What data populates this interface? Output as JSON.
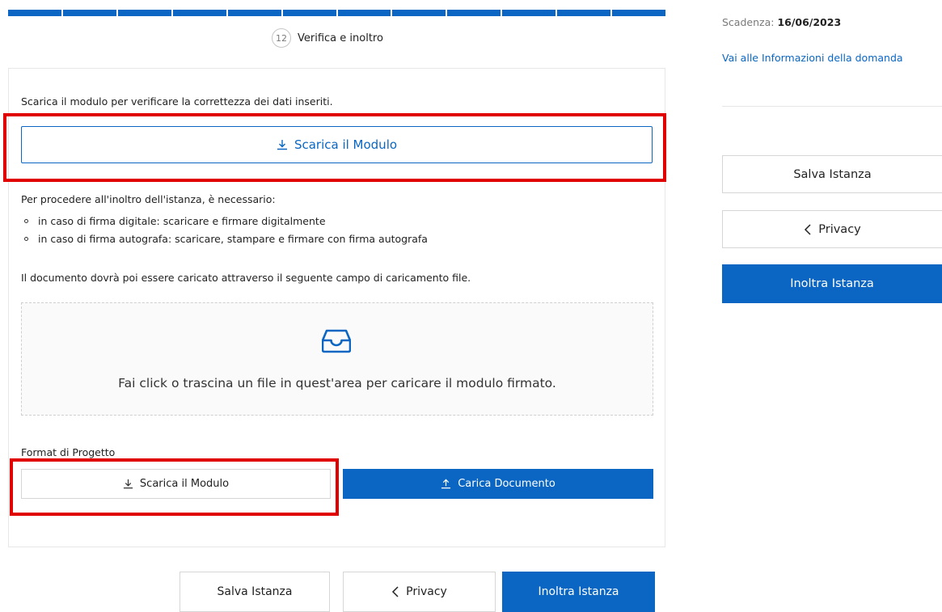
{
  "progress": {
    "total_steps": 12,
    "current_step": 12
  },
  "step": {
    "number": "12",
    "label": "Verifica e inoltro"
  },
  "download_section": {
    "instruction": "Scarica il modulo per verificare la correttezza dei dati inseriti.",
    "download_button": "Scarica il Modulo"
  },
  "requirements": {
    "intro": "Per procedere all'inoltro dell'istanza, è necessario:",
    "items": [
      "in caso di firma digitale: scaricare e firmare digitalmente",
      "in caso di firma autografa: scaricare, stampare e firmare con firma autografa"
    ]
  },
  "upload_note": "Il documento dovrà poi essere caricato attraverso il seguente campo di caricamento file.",
  "dropzone": {
    "message": "Fai click o trascina un file in quest'area per caricare il modulo firmato.",
    "icon": "inbox-icon"
  },
  "format": {
    "label": "Format di Progetto",
    "download_button": "Scarica il Modulo",
    "upload_button": "Carica Documento"
  },
  "footer_actions": {
    "save": "Salva Istanza",
    "privacy": "Privacy",
    "submit": "Inoltra Istanza"
  },
  "sidebar": {
    "deadline_label": "Scadenza:",
    "deadline_value": "16/06/2023",
    "info_link": "Vai alle Informazioni della domanda",
    "save": "Salva Istanza",
    "privacy": "Privacy",
    "submit": "Inoltra Istanza"
  },
  "colors": {
    "primary": "#0a66c2",
    "highlight": "#e00000"
  }
}
